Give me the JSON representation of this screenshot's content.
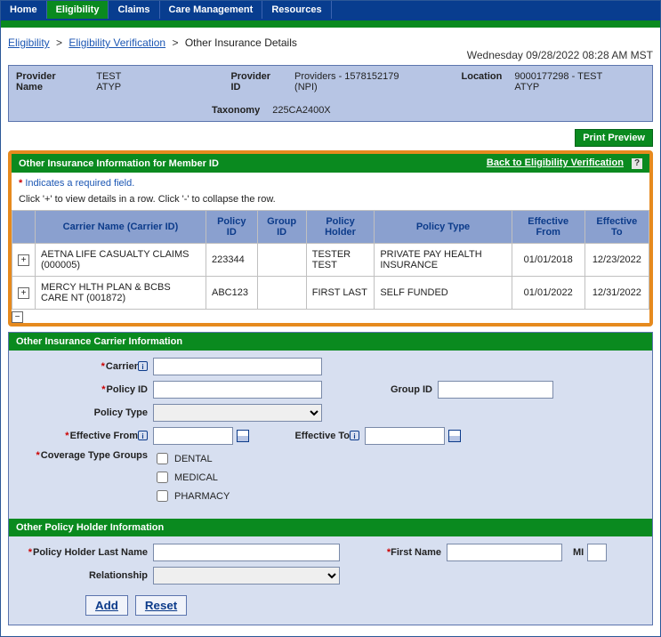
{
  "tabs": {
    "home": "Home",
    "eligibility": "Eligibility",
    "claims": "Claims",
    "care": "Care Management",
    "resources": "Resources"
  },
  "breadcrumb": {
    "eligibility": "Eligibility",
    "verification": "Eligibility Verification",
    "current": "Other Insurance Details"
  },
  "timestamp": "Wednesday 09/28/2022 08:28 AM MST",
  "provider": {
    "name_label": "Provider Name",
    "name_value": "TEST ATYP",
    "id_label": "Provider ID",
    "id_value": "Providers - 1578152179 (NPI)",
    "location_label": "Location",
    "location_value": "9000177298 - TEST ATYP",
    "taxonomy_label": "Taxonomy",
    "taxonomy_value": "225CA2400X"
  },
  "actions": {
    "print_preview": "Print Preview"
  },
  "oii": {
    "header": "Other Insurance Information for Member ID",
    "back_link": "Back to Eligibility Verification",
    "required_note": "Indicates a required field.",
    "instruction": "Click '+' to view details in a row. Click '-' to collapse the row.",
    "columns": {
      "carrier": "Carrier Name (Carrier ID)",
      "policy_id": "Policy ID",
      "group_id": "Group ID",
      "holder": "Policy Holder",
      "type": "Policy Type",
      "eff_from": "Effective From",
      "eff_to": "Effective To"
    },
    "rows": [
      {
        "carrier": "AETNA LIFE CASUALTY CLAIMS (000005)",
        "policy_id": "223344",
        "group_id": "",
        "holder": "TESTER TEST",
        "type": "PRIVATE PAY HEALTH INSURANCE",
        "eff_from": "01/01/2018",
        "eff_to": "12/23/2022"
      },
      {
        "carrier": "MERCY HLTH PLAN & BCBS CARE NT (001872)",
        "policy_id": "ABC123",
        "group_id": "",
        "holder": "FIRST LAST",
        "type": "SELF FUNDED",
        "eff_from": "01/01/2022",
        "eff_to": "12/31/2022"
      }
    ]
  },
  "carrier_section": {
    "header": "Other Insurance Carrier Information",
    "carrier": "Carrier",
    "policy_id": "Policy ID",
    "group_id": "Group ID",
    "policy_type": "Policy Type",
    "eff_from": "Effective From",
    "eff_to": "Effective To",
    "coverage_groups": "Coverage Type Groups",
    "dental": "DENTAL",
    "medical": "MEDICAL",
    "pharmacy": "PHARMACY"
  },
  "holder_section": {
    "header": "Other Policy Holder Information",
    "last_name": "Policy Holder Last Name",
    "first_name": "First Name",
    "mi": "MI",
    "relationship": "Relationship"
  },
  "buttons": {
    "add": "Add",
    "reset": "Reset"
  }
}
